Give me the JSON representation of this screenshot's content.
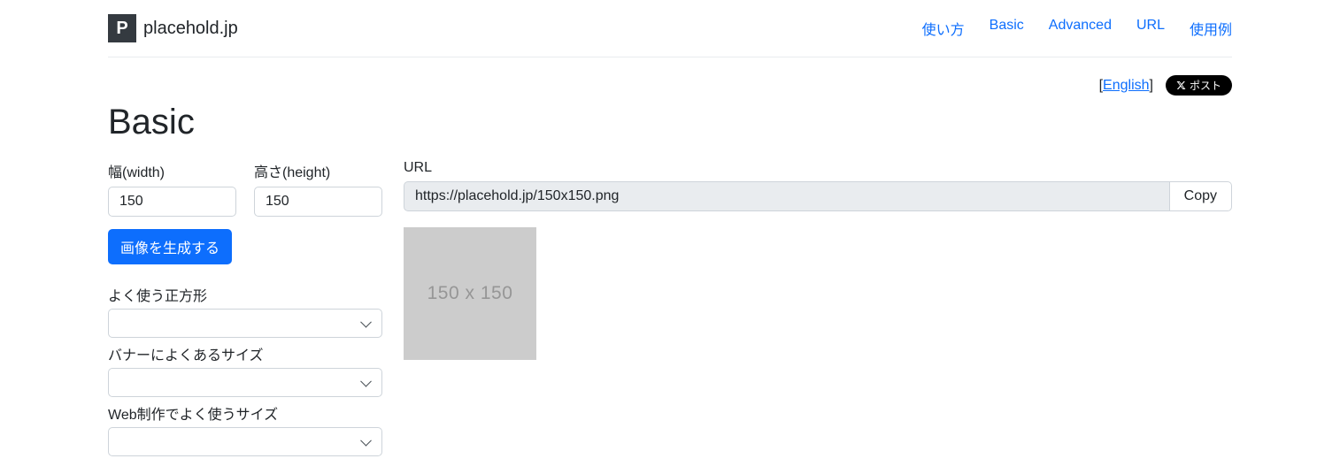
{
  "brand": {
    "icon_letter": "P",
    "name": "placehold.jp"
  },
  "nav": [
    {
      "label": "使い方"
    },
    {
      "label": "Basic"
    },
    {
      "label": "Advanced"
    },
    {
      "label": "URL"
    },
    {
      "label": "使用例"
    }
  ],
  "lang_switch": {
    "open": "[",
    "link": "English",
    "close": "]"
  },
  "post_button": "ポスト",
  "page_title": "Basic",
  "form": {
    "width_label": "幅(width)",
    "width_value": "150",
    "height_label": "高さ(height)",
    "height_value": "150",
    "generate_button": "画像を生成する",
    "preset_square_label": "よく使う正方形",
    "preset_banner_label": "バナーによくあるサイズ",
    "preset_web_label": "Web制作でよく使うサイズ"
  },
  "result": {
    "url_label": "URL",
    "url_value": "https://placehold.jp/150x150.png",
    "copy_button": "Copy",
    "preview_text": "150 x 150"
  }
}
